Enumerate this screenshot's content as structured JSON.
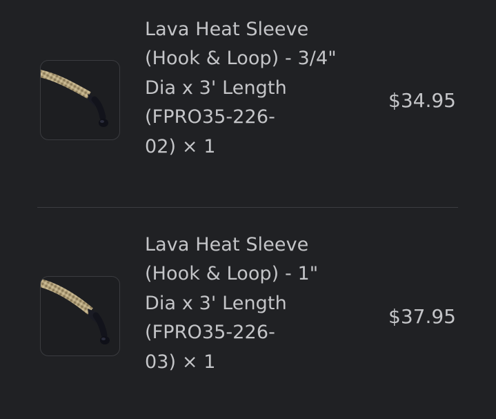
{
  "order_summary": {
    "items": [
      {
        "name": "Lava Heat Sleeve\n(Hook & Loop) - 3/4\"\nDia x 3' Length\n(FPRO35-226-\n02) × 1",
        "price": "$34.95",
        "thumbnail_icon": "heat-sleeve-product-image"
      },
      {
        "name": "Lava Heat Sleeve\n(Hook & Loop) - 1\"\nDia x 3' Length\n(FPRO35-226-\n03) × 1",
        "price": "$37.95",
        "thumbnail_icon": "heat-sleeve-product-image"
      }
    ]
  },
  "colors": {
    "background": "#202124",
    "text": "#c4c5c8",
    "divider": "#3c3d41",
    "thumbnail_border": "#3b3c40"
  }
}
